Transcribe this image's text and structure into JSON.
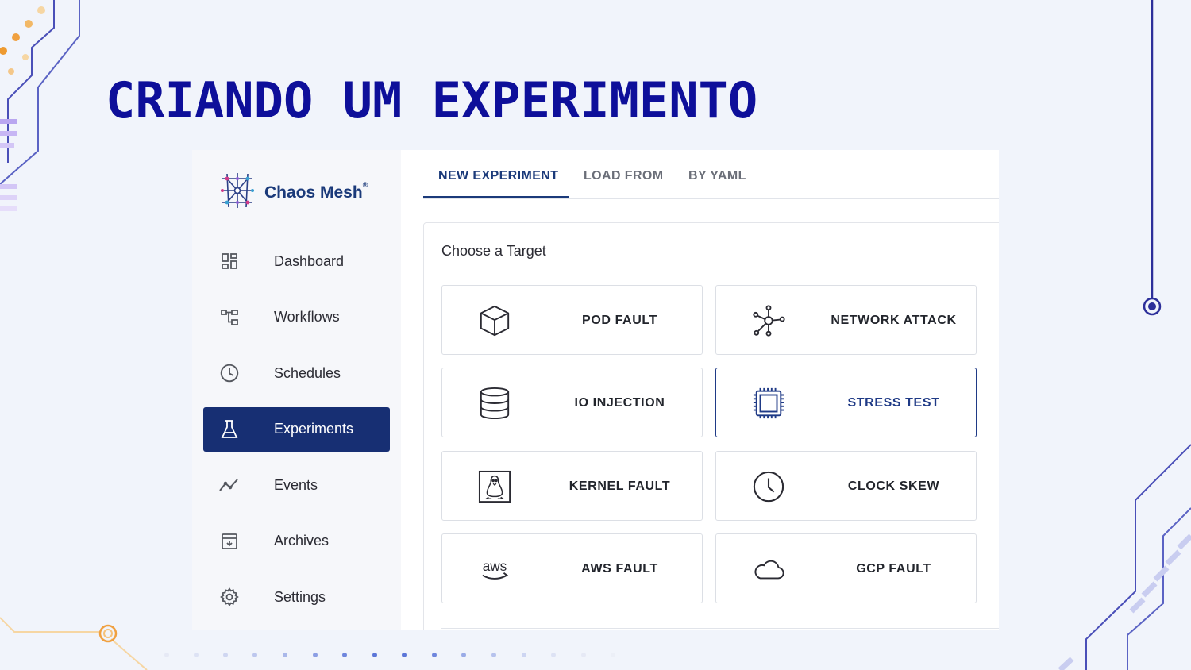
{
  "slide": {
    "title": "CRIANDO UM EXPERIMENTO",
    "title_color": "#0e0f9a"
  },
  "app": {
    "brand": {
      "name": "Chaos Mesh",
      "reg_mark": "®",
      "logo_icon": "chaos-mesh-logo"
    },
    "accent_color": "#172f73",
    "sidebar": {
      "items": [
        {
          "label": "Dashboard",
          "icon": "dashboard-icon",
          "active": false
        },
        {
          "label": "Workflows",
          "icon": "workflows-icon",
          "active": false
        },
        {
          "label": "Schedules",
          "icon": "schedules-icon",
          "active": false
        },
        {
          "label": "Experiments",
          "icon": "flask-icon",
          "active": true
        },
        {
          "label": "Events",
          "icon": "events-icon",
          "active": false
        },
        {
          "label": "Archives",
          "icon": "archive-icon",
          "active": false
        },
        {
          "label": "Settings",
          "icon": "gear-icon",
          "active": false
        }
      ]
    },
    "tabs": [
      {
        "label": "NEW EXPERIMENT",
        "active": true
      },
      {
        "label": "LOAD FROM",
        "active": false
      },
      {
        "label": "BY YAML",
        "active": false
      }
    ],
    "panel": {
      "title": "Choose a Target",
      "targets": [
        {
          "label": "POD FAULT",
          "icon": "cube-icon",
          "selected": false
        },
        {
          "label": "NETWORK ATTACK",
          "icon": "network-icon",
          "selected": false
        },
        {
          "label": "IO INJECTION",
          "icon": "database-icon",
          "selected": false
        },
        {
          "label": "STRESS TEST",
          "icon": "cpu-icon",
          "selected": true
        },
        {
          "label": "KERNEL FAULT",
          "icon": "linux-icon",
          "selected": false
        },
        {
          "label": "CLOCK SKEW",
          "icon": "clock-icon",
          "selected": false
        },
        {
          "label": "AWS FAULT",
          "icon": "aws-icon",
          "selected": false
        },
        {
          "label": "GCP FAULT",
          "icon": "cloud-icon",
          "selected": false
        }
      ]
    }
  }
}
